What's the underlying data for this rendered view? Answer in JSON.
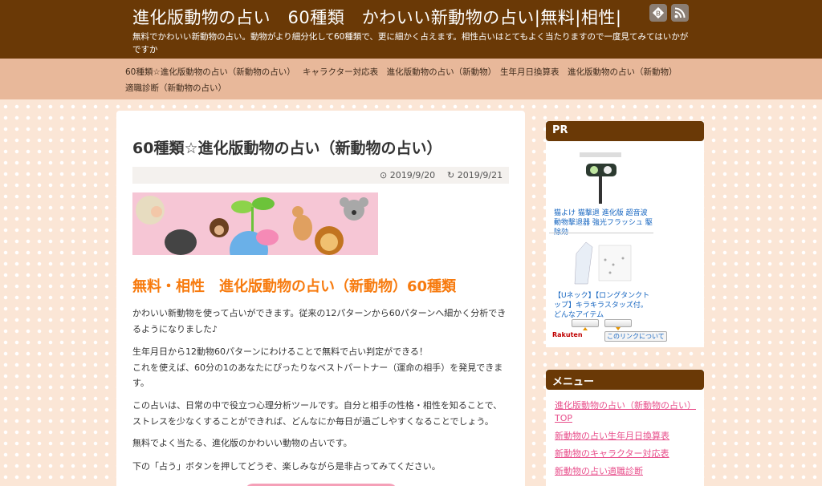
{
  "header": {
    "site_title": "進化版動物の占い　60種類　かわいい新動物の占い|無料|相性|",
    "site_desc": "無料でかわいい新動物の占い。動物がより細分化して60種類で、更に細かく占えます。相性占いはとてもよく当たりますので一度見てみてはいかがですか",
    "social_icons": [
      "hatena-bookmark-icon",
      "rss-icon"
    ]
  },
  "nav": {
    "items": [
      "60種類☆進化版動物の占い（新動物の占い）",
      "キャラクター対応表　進化版動物の占い（新動物）",
      "生年月日換算表　進化版動物の占い（新動物）",
      "適職診断（新動物の占い）"
    ]
  },
  "article": {
    "title": "60種類☆進化版動物の占い（新動物の占い）",
    "published": "2019/9/20",
    "updated": "2019/9/21",
    "heading": "無料・相性　進化版動物の占い（新動物）60種類",
    "paragraphs": [
      "かわいい新動物を使って占いができます。従来の12パターンから60パターンへ細かく分析できるようになりました♪",
      "生年月日から12動物60パターンにわけることで無料で占い判定ができる！\nこれを使えば、60分の1のあなたにぴったりなベストパートナー（運命の相手）を発見できます。",
      "この占いは、日常の中で役立つ心理分析ツールです。自分と相手の性格・相性を知ることで、ストレスを少なくすることができれば、どんなにか毎日が過ごしやすくなることでしょう。",
      "無料でよく当たる、進化版のかわいい動物の占いです。",
      "下の「占う」ボタンを押してどうぞ、楽しみながら是非占ってみてください。"
    ]
  },
  "sidebar": {
    "pr": {
      "title": "PR",
      "item1": "猫よけ 猫撃退 進化版 超音波動物撃退器 強光フラッシュ 駆除効",
      "item2": "【Uネック】【ロングタンクトップ】キラキラスタッズ付。どんなアイテム",
      "rakuten": "Rakuten",
      "link_label": "このリンクについて"
    },
    "menu": {
      "title": "メニュー",
      "items": [
        "進化版動物の占い（新動物の占い）TOP",
        "新動物の占い生年月日換算表",
        "新動物のキャラクター対応表",
        "新動物の占い適職診断"
      ]
    }
  },
  "colors": {
    "header_bg": "#6a3906",
    "nav_bg": "#e8b89a",
    "heading_orange": "#f77b0f",
    "menu_link_pink": "#e8508c"
  }
}
